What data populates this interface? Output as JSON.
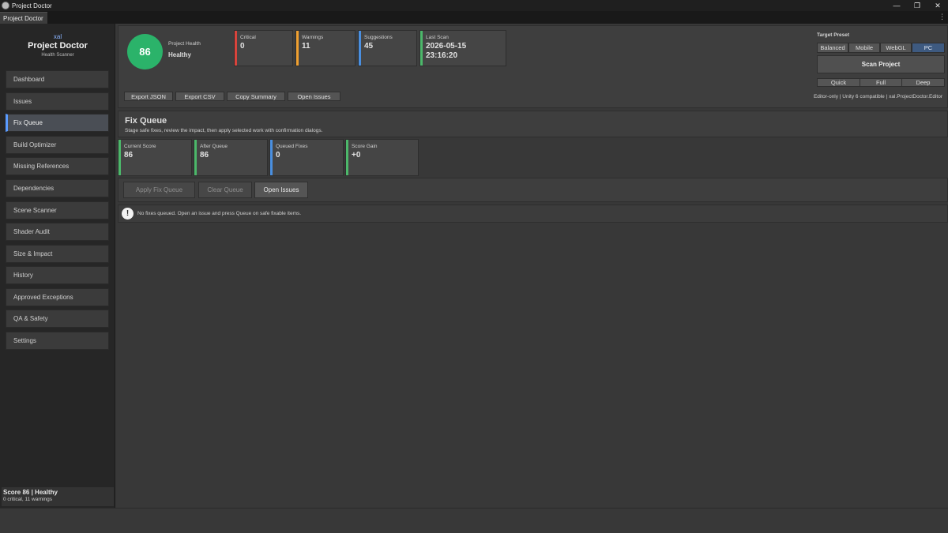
{
  "window": {
    "title": "Project Doctor",
    "minimize": "—",
    "restore": "❐",
    "close": "✕"
  },
  "tab": {
    "label": "Project Doctor",
    "menu": "⋮"
  },
  "sidebar": {
    "brand_sub": "xal",
    "brand_title": "Project Doctor",
    "brand_tag": "Health Scanner",
    "items": [
      {
        "label": "Dashboard"
      },
      {
        "label": "Issues"
      },
      {
        "label": "Fix Queue"
      },
      {
        "label": "Build Optimizer"
      },
      {
        "label": "Missing References"
      },
      {
        "label": "Dependencies"
      },
      {
        "label": "Scene Scanner"
      },
      {
        "label": "Shader Audit"
      },
      {
        "label": "Size & Impact"
      },
      {
        "label": "History"
      },
      {
        "label": "Approved Exceptions"
      },
      {
        "label": "QA & Safety"
      },
      {
        "label": "Settings"
      }
    ],
    "active_item": "Fix Queue",
    "footer_line1": "Score 86 | Healthy",
    "footer_line2": "0 critical, 11 warnings"
  },
  "header": {
    "score": "86",
    "health_label": "Project Health",
    "health_status": "Healthy",
    "stats": {
      "critical": {
        "label": "Critical",
        "value": "0",
        "color": "#d9443c"
      },
      "warnings": {
        "label": "Warnings",
        "value": "11",
        "color": "#f0a030"
      },
      "suggestions": {
        "label": "Suggestions",
        "value": "45",
        "color": "#4a8fe0"
      },
      "last_scan": {
        "label": "Last Scan",
        "date": "2026-05-15",
        "time": "23:16:20",
        "color": "#4cb86a"
      }
    },
    "export_buttons": {
      "export_json": "Export JSON",
      "export_csv": "Export CSV",
      "copy_summary": "Copy Summary",
      "open_issues": "Open Issues"
    },
    "target_preset": {
      "label": "Target Preset",
      "options": [
        "Balanced",
        "Mobile",
        "WebGL",
        "PC"
      ],
      "selected": "PC"
    },
    "scan_button": "Scan Project",
    "scan_modes": [
      "Quick",
      "Full",
      "Deep"
    ],
    "editor_note": "Editor-only | Unity 6 compatible | xal.ProjectDoctor.Editor"
  },
  "fix_queue": {
    "title": "Fix Queue",
    "description": "Stage safe fixes, review the impact, then apply selected work with confirmation dialogs.",
    "stats": {
      "current_score": {
        "label": "Current Score",
        "value": "86",
        "color": "#4cb86a"
      },
      "after_queue": {
        "label": "After Queue",
        "value": "86",
        "color": "#4cb86a"
      },
      "queued_fixes": {
        "label": "Queued Fixes",
        "value": "0",
        "color": "#4a8fe0"
      },
      "score_gain": {
        "label": "Score Gain",
        "value": "+0",
        "color": "#4cb86a"
      }
    },
    "buttons": {
      "apply": "Apply Fix Queue",
      "clear": "Clear Queue",
      "open_issues": "Open Issues"
    },
    "empty_icon": "!",
    "empty_message": "No fixes queued. Open an issue and press Queue on safe fixable items."
  }
}
